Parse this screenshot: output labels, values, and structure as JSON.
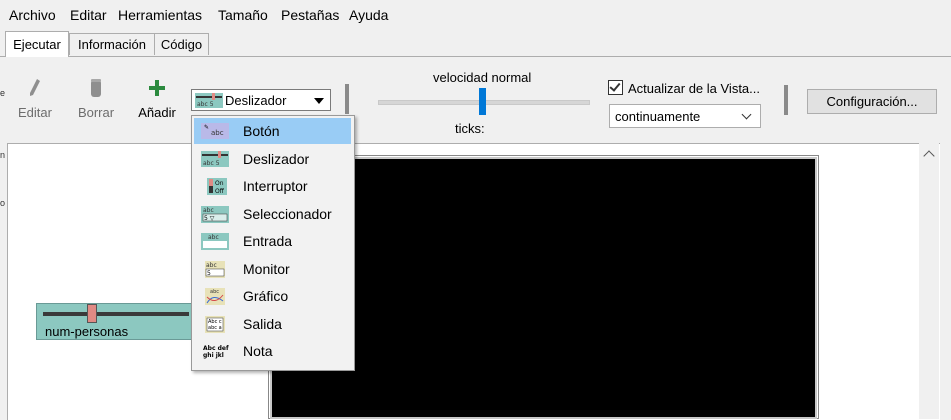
{
  "menubar": {
    "items": [
      "Archivo",
      "Editar",
      "Herramientas",
      "Tamaño",
      "Pestañas",
      "Ayuda"
    ]
  },
  "tabs": [
    {
      "label": "Ejecutar",
      "active": true
    },
    {
      "label": "Información",
      "active": false
    },
    {
      "label": "Código",
      "active": false
    }
  ],
  "toolbar": {
    "edit_label": "Editar",
    "delete_label": "Borrar",
    "add_label": "Añadir",
    "widget_combo_value": "Deslizador",
    "speed_label": "velocidad normal",
    "ticks_label": "ticks:",
    "update_view_label": "Actualizar de la Vista...",
    "update_mode_value": "continuamente",
    "settings_label": "Configuración..."
  },
  "widget_menu": {
    "items": [
      {
        "label": "Botón",
        "icon": "button-widget-icon",
        "highlighted": true
      },
      {
        "label": "Deslizador",
        "icon": "slider-widget-icon",
        "highlighted": false
      },
      {
        "label": "Interruptor",
        "icon": "switch-widget-icon",
        "highlighted": false
      },
      {
        "label": "Seleccionador",
        "icon": "chooser-widget-icon",
        "highlighted": false
      },
      {
        "label": "Entrada",
        "icon": "input-widget-icon",
        "highlighted": false
      },
      {
        "label": "Monitor",
        "icon": "monitor-widget-icon",
        "highlighted": false
      },
      {
        "label": "Gráfico",
        "icon": "plot-widget-icon",
        "highlighted": false
      },
      {
        "label": "Salida",
        "icon": "output-widget-icon",
        "highlighted": false
      },
      {
        "label": "Nota",
        "icon": "note-widget-icon",
        "highlighted": false
      }
    ]
  },
  "workspace": {
    "slider_widget_name": "num-personas"
  },
  "colors": {
    "accent": "#0078d7",
    "highlight": "#99ccf5",
    "slider_widget_bg": "#8cc8c0",
    "view_bg": "#000000"
  }
}
